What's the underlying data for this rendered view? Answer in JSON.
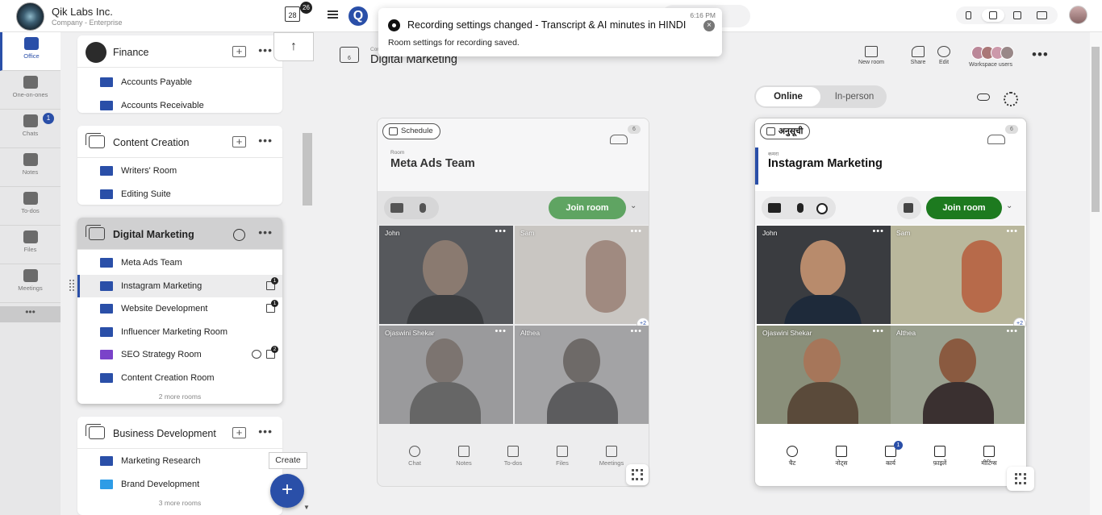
{
  "org": {
    "name": "Qik Labs Inc.",
    "subtitle": "Company - Enterprise",
    "calendar_day": "28",
    "calendar_badge": "26"
  },
  "nav": {
    "items": [
      {
        "label": "Office",
        "icon": "briefcase-icon",
        "active": true
      },
      {
        "label": "One-on-ones",
        "icon": "people-icon"
      },
      {
        "label": "Chats",
        "icon": "chat-icon",
        "badge": "1"
      },
      {
        "label": "Notes",
        "icon": "notes-icon"
      },
      {
        "label": "To-dos",
        "icon": "checkbox-icon"
      },
      {
        "label": "Files",
        "icon": "file-icon"
      },
      {
        "label": "Meetings",
        "icon": "meetings-icon"
      }
    ],
    "more": "•••"
  },
  "groups": [
    {
      "title": "Finance",
      "rooms": [
        "Accounts Payable",
        "Accounts Receivable"
      ]
    },
    {
      "title": "Content Creation",
      "rooms": [
        "Writers' Room",
        "Editing Suite"
      ]
    },
    {
      "title": "Digital Marketing",
      "selected": true,
      "rooms": [
        "Meta Ads Team",
        "Instagram Marketing",
        "Website Development",
        "Influencer Marketing Room",
        "SEO Strategy Room",
        "Content Creation Room"
      ],
      "more": "2 more rooms",
      "badges": {
        "instagram": "1",
        "website": "1",
        "seo": "2"
      }
    },
    {
      "title": "Business Development",
      "rooms": [
        "Marketing Research",
        "Brand Development"
      ],
      "more": "3 more rooms"
    }
  ],
  "create_tooltip": "Create",
  "fab_label": "+",
  "scroll_up": "↑",
  "toast": {
    "title": "Recording settings changed - Transcript & AI minutes in HINDI",
    "body": "Room settings for recording saved.",
    "time": "6:16 PM",
    "close": "×"
  },
  "workspace": {
    "crumb": "Con",
    "title": "Digital Marketing",
    "icon_count": "6",
    "toolbar": {
      "new_room": "New room",
      "share": "Share",
      "edit": "Edit",
      "users": "Workspace users"
    }
  },
  "mode_toggle": {
    "online": "Online",
    "inperson": "In-person"
  },
  "rooms": [
    {
      "schedule": "Schedule",
      "count": "6",
      "small": "Room",
      "name": "Meta Ads Team",
      "join": "Join room",
      "tiles": [
        "John",
        "Sam",
        "Ojaswini Shekar",
        "Althea"
      ],
      "extra": "+2",
      "footer": [
        "Chat",
        "Notes",
        "To-dos",
        "Files",
        "Meetings"
      ]
    },
    {
      "schedule": "अनुसूची",
      "count": "6",
      "small": "कमरा",
      "name": "Instagram Marketing",
      "join": "Join room",
      "tiles": [
        "John",
        "Sam",
        "Ojaswini Shekar",
        "Althea"
      ],
      "extra": "+2",
      "footer": [
        "चैट",
        "नोट्स",
        "कार्य",
        "फ़ाइलें",
        "मीटिंग्स"
      ],
      "todo_badge": "1"
    }
  ],
  "colors": {
    "accent": "#2a4fa8",
    "join_green_muted": "#5fa462",
    "join_green": "#1d7a1f"
  }
}
